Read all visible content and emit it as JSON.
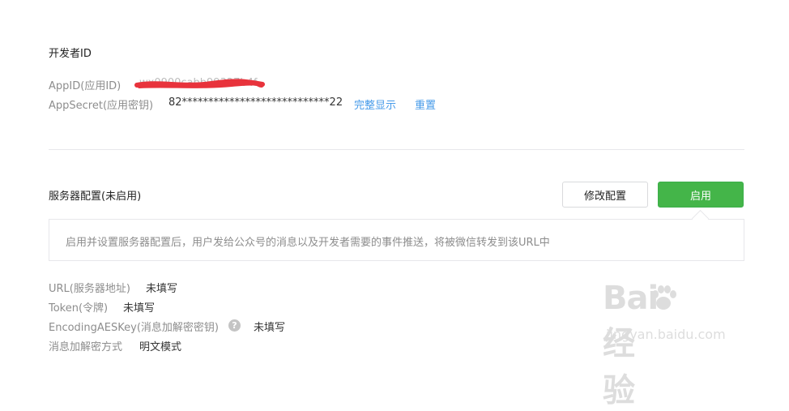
{
  "developer": {
    "title": "开发者ID",
    "appid_label": "AppID(应用ID)",
    "appid_value": "wx0900cabb99327b4f",
    "appsecret_label": "AppSecret(应用密钥)",
    "appsecret_value": "82****************************22",
    "show_full_link": "完整显示",
    "reset_link": "重置"
  },
  "server": {
    "title": "服务器配置(未启用)",
    "modify_button": "修改配置",
    "enable_button": "启用",
    "tip": "启用并设置服务器配置后，用户发给公众号的消息以及开发者需要的事件推送，将被微信转发到该URL中",
    "fields": [
      {
        "label": "URL(服务器地址)",
        "value": "未填写"
      },
      {
        "label": "Token(令牌)",
        "value": "未填写"
      },
      {
        "label": "EncodingAESKey(消息加解密密钥)",
        "value": "未填写"
      },
      {
        "label": "消息加解密方式",
        "value": "明文模式"
      }
    ],
    "help_icon": "question-circle-icon"
  },
  "watermark": {
    "logo_text": "Bai经验",
    "url": "jingyan.baidu.com"
  },
  "colors": {
    "link": "#459ae9",
    "primary": "#44b549",
    "redact": "#e8333c"
  }
}
